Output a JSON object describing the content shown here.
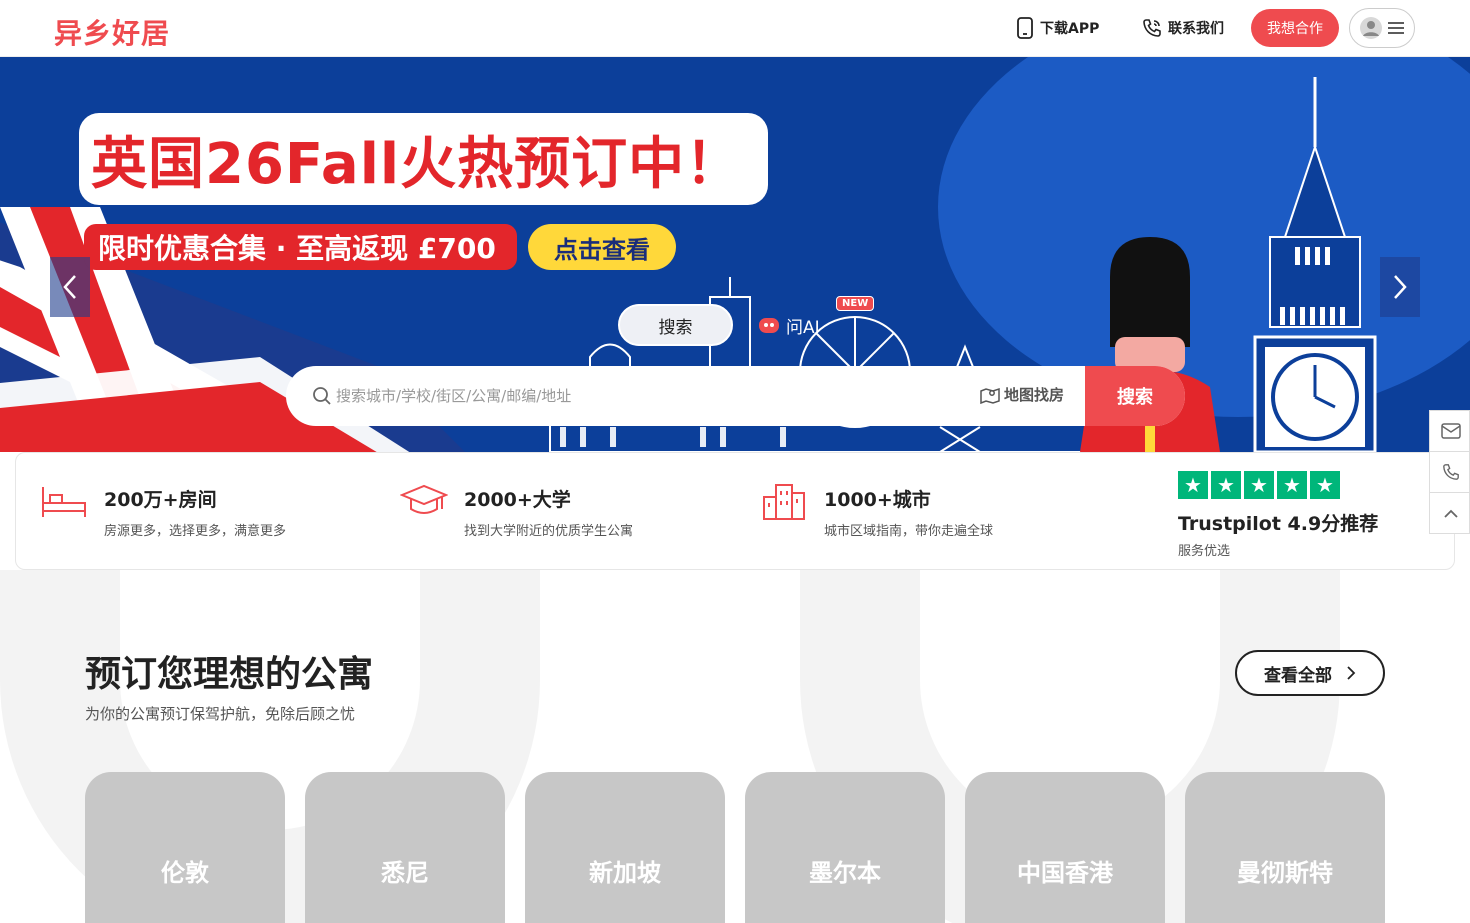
{
  "header": {
    "logo": "异乡好居",
    "download_label": "下载APP",
    "contact_label": "联系我们",
    "cooperate_label": "我想合作"
  },
  "banner": {
    "headline": "英国26Fall火热预订中！",
    "promo": "限时优惠合集 · 至高返现 £700",
    "view_label": "点击查看"
  },
  "search": {
    "tab_search": "搜索",
    "tab_ai": "问AI",
    "new_badge": "NEW",
    "placeholder": "搜索城市/学校/街区/公寓/邮编/地址",
    "map_label": "地图找房",
    "button_label": "搜索"
  },
  "features": [
    {
      "title": "200万+房间",
      "desc": "房源更多，选择更多，满意更多",
      "icon": "bed-icon"
    },
    {
      "title": "2000+大学",
      "desc": "找到大学附近的优质学生公寓",
      "icon": "graduation-cap-icon"
    },
    {
      "title": "1000+城市",
      "desc": "城市区域指南，带你走遍全球",
      "icon": "city-buildings-icon"
    }
  ],
  "trustpilot": {
    "rating_text": "Trustpilot 4.9分推荐",
    "sub": "服务优选",
    "stars": 5
  },
  "section": {
    "title": "预订您理想的公寓",
    "subtitle": "为你的公寓预订保驾护航，免除后顾之忧",
    "view_all": "查看全部"
  },
  "cities": [
    "伦敦",
    "悉尼",
    "新加坡",
    "墨尔本",
    "中国香港",
    "曼彻斯特"
  ],
  "colors": {
    "brand": "#ef4b4f",
    "banner_blue": "#0c3f9a",
    "promo_yellow": "#ffd83a",
    "trustpilot_green": "#00b67a"
  }
}
